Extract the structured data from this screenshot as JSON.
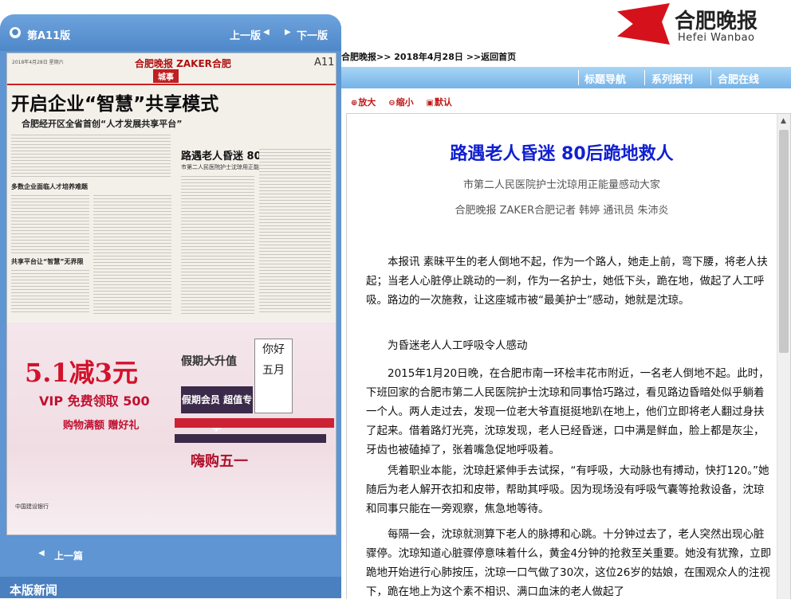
{
  "left": {
    "edition_label": "第A11版",
    "prev_link": "上一版",
    "next_link": "下一版",
    "bottom_prev": "上一篇",
    "section_news": "本版新闻"
  },
  "newspaper_thumb": {
    "date": "2018年4月28日 星期六",
    "logo": "合肥晚报 ZAKER合肥",
    "page": "A11",
    "section": "城事",
    "headline1": "开启企业“智慧”共享模式",
    "sub1": "合肥经开区全省首创“人才发展共享平台”",
    "sub2": "多数企业面临人才培养难题",
    "sub3": "共享平台让“智慧”无界限",
    "headline2": "路遇老人昏迷  80后跪地救人",
    "sub4": "市第二人民医院护士沈琼用正能量感动大家",
    "ad_big": "5.1减3元",
    "ad_vip": "VIP 免费领取 500",
    "ad_gift": "购物满额 赠好礼",
    "ad_title": "假期大升值",
    "ad_box1": "假期会员 超值专享",
    "ad_hello": "你好 五月",
    "ad_stamp": "嗨购五一",
    "ad_bank": "中国建设银行"
  },
  "logo": {
    "cn": "合肥晚报",
    "en": "Hefei Wanbao"
  },
  "breadcrumb": {
    "site": "合肥晚报>>",
    "date": "2018年4月28日",
    "home": ">>返回首页"
  },
  "nav": [
    "标题导航",
    "系列报刊",
    "合肥在线"
  ],
  "tools": {
    "zoom_in": "放大",
    "zoom_out": "缩小",
    "default": "默认"
  },
  "article": {
    "title": "路遇老人昏迷 80后跪地救人",
    "subtitle": "市第二人民医院护士沈琼用正能量感动大家",
    "byline": "合肥晚报 ZAKER合肥记者 韩婷 通讯员 朱沛炎",
    "paragraphs": [
      "本报讯 素昧平生的老人倒地不起，作为一个路人，她走上前，弯下腰，将老人扶起；当老人心脏停止跳动的一刹，作为一名护士，她低下头，跪在地，做起了人工呼吸。路边的一次施救，让这座城市被“最美护士”感动，她就是沈琼。",
      "为昏迷老人人工呼吸令人感动",
      "2015年1月20日晚，在合肥市南一环桧丰花市附近，一名老人倒地不起。此时，下班回家的合肥市第二人民医院护士沈琼和同事恰巧路过，看见路边昏暗处似乎躺着一个人。两人走过去，发现一位老大爷直挺挺地趴在地上，他们立即将老人翻过身扶了起来。借着路灯光亮，沈琼发现，老人已经昏迷，口中满是鲜血，脸上都是灰尘，牙齿也被磕掉了，张着嘴急促地呼吸着。",
      "凭着职业本能，沈琼赶紧伸手去试探，“有呼吸，大动脉也有搏动，快打120。”她随后为老人解开衣扣和皮带，帮助其呼吸。因为现场没有呼吸气囊等抢救设备，沈琼和同事只能在一旁观察，焦急地等待。",
      "每隔一会，沈琼就测算下老人的脉搏和心跳。十分钟过去了，老人突然出现心脏骤停。沈琼知道心脏骤停意味着什么，黄金4分钟的抢救至关重要。她没有犹豫，立即跪地开始进行心肺按压，沈琼一口气做了30次，这位26岁的姑娘，在围观众人的注视下，跪在地上为这个素不相识、满口血沫的老人做起了"
    ]
  }
}
